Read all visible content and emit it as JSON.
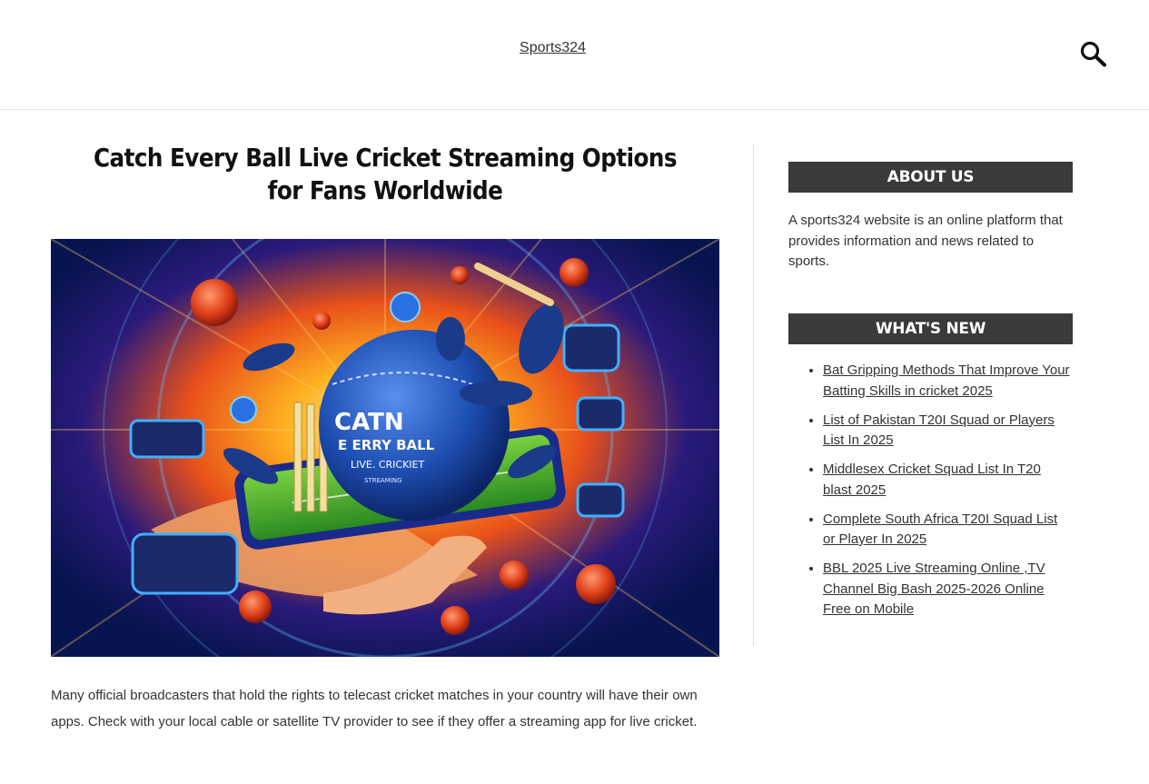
{
  "header": {
    "site_title": "Sports324",
    "search_icon": "search-icon"
  },
  "post": {
    "title": "Catch Every Ball Live Cricket Streaming Options for Fans Worldwide",
    "hero_text_line1": "CATN",
    "hero_text_line2": "E ERRY BALL",
    "hero_text_line3": "LIVE. CRICKIET",
    "hero_text_line4": "STREAMING",
    "body": "Many official broadcasters that hold the rights to telecast cricket matches in your country will have their own apps. Check with your local cable or satellite TV provider to see if they offer a streaming app for live cricket."
  },
  "sidebar": {
    "about": {
      "title": "ABOUT US",
      "text": "A sports324 website is an online platform that provides information and news related to sports."
    },
    "whats_new": {
      "title": "WHAT'S NEW",
      "items": [
        {
          "label": "Bat Gripping Methods That Improve Your Batting Skills in cricket 2025"
        },
        {
          "label": "List of Pakistan T20I Squad or Players List In 2025"
        },
        {
          "label": "Middlesex Cricket Squad List In T20 blast 2025"
        },
        {
          "label": "Complete South Africa T20I Squad List or Player In 2025"
        },
        {
          "label": "BBL 2025 Live Streaming Online ,TV Channel Big Bash 2025-2026 Online Free on Mobile"
        }
      ]
    }
  },
  "colors": {
    "widget_bg": "#3a3a3c",
    "hero_bg": "#0a1a6a",
    "ball": "#1e4fb3"
  }
}
